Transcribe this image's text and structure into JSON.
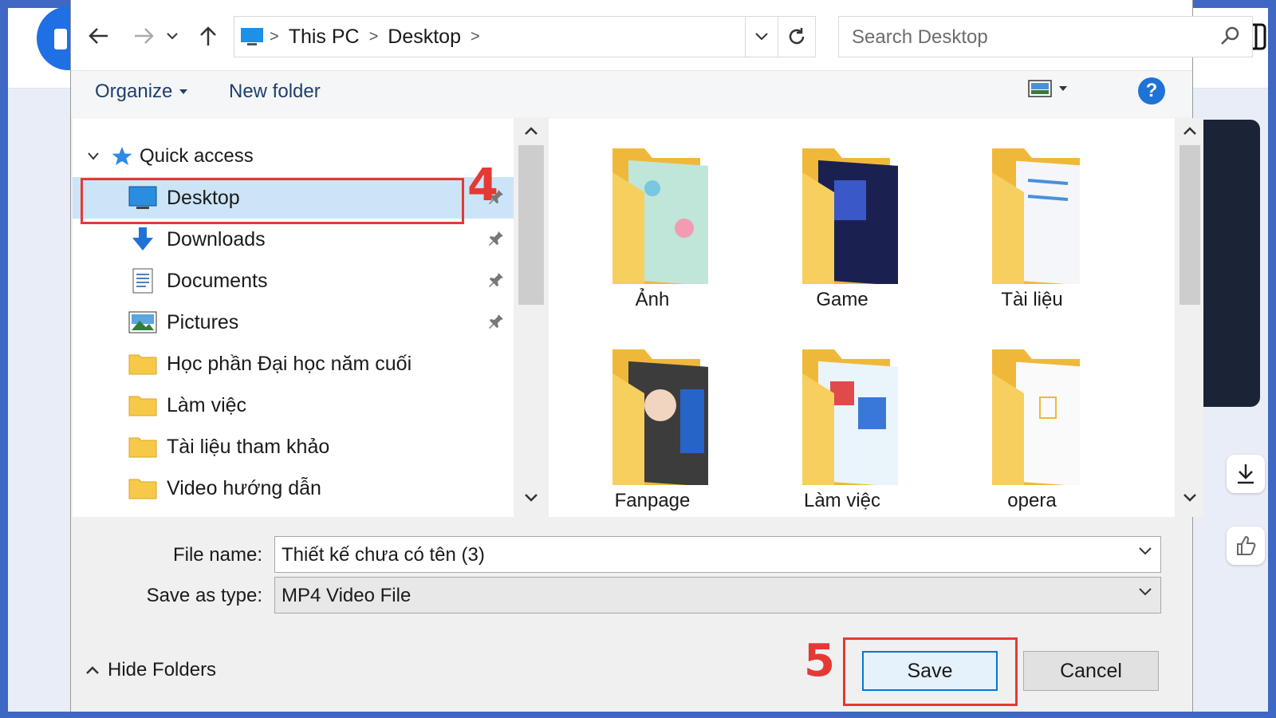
{
  "dialog": {
    "breadcrumb": [
      "This PC",
      "Desktop"
    ],
    "search_placeholder": "Search Desktop",
    "toolbar": {
      "organize": "Organize",
      "new_folder": "New folder",
      "help": "?"
    },
    "quick_access": "Quick access",
    "nav_items": [
      {
        "label": "Desktop",
        "icon": "desktop-icon",
        "pinned": true,
        "selected": true
      },
      {
        "label": "Downloads",
        "icon": "downloads-icon",
        "pinned": true
      },
      {
        "label": "Documents",
        "icon": "documents-icon",
        "pinned": true
      },
      {
        "label": "Pictures",
        "icon": "pictures-icon",
        "pinned": true
      },
      {
        "label": "Học phần Đại học năm cuối",
        "icon": "folder-icon"
      },
      {
        "label": "Làm việc",
        "icon": "folder-icon"
      },
      {
        "label": "Tài liệu tham khảo",
        "icon": "folder-icon"
      },
      {
        "label": "Video hướng dẫn",
        "icon": "folder-icon"
      }
    ],
    "folders": [
      "Ảnh",
      "Game",
      "Tài liệu",
      "Fanpage",
      "Làm việc",
      "opera"
    ],
    "file_name_label": "File name:",
    "file_name_value": "Thiết kế chưa có tên (3)",
    "save_type_label": "Save as type:",
    "save_type_value": "MP4 Video File",
    "hide_folders": "Hide Folders",
    "save": "Save",
    "cancel": "Cancel"
  },
  "annotations": {
    "step_4": "4",
    "step_5": "5"
  },
  "colors": {
    "accent": "#0078d7",
    "highlight": "#e53935",
    "selection": "#cce4f7",
    "folder": "#f7c948"
  }
}
